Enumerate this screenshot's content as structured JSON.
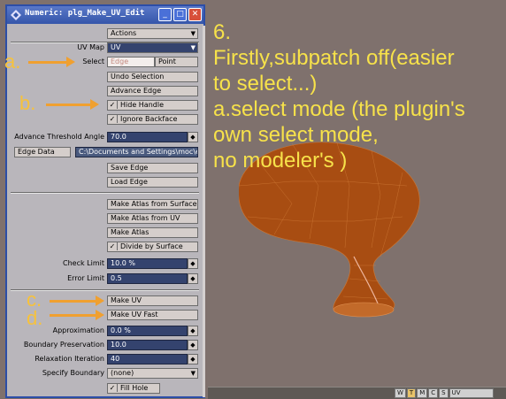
{
  "window": {
    "title": "Numeric: plg_Make_UV_Edit"
  },
  "controls": {
    "actions_label": "Actions",
    "uv_map_label": "UV Map",
    "uv_map_value": "UV",
    "select_label": "Select",
    "select_edge": "Edge",
    "select_point": "Point",
    "undo_selection": "Undo Selection",
    "advance_edge": "Advance Edge",
    "hide_handle": "Hide Handle",
    "ignore_backface": "Ignore Backface",
    "adv_threshold_label": "Advance Threshold Angle",
    "adv_threshold_value": "70.0",
    "edge_data_button": "Edge Data",
    "edge_data_path": "C:\\Documents and Settings\\moc\\ed",
    "save_edge": "Save Edge",
    "load_edge": "Load Edge",
    "make_atlas_surface": "Make Atlas from Surface",
    "make_atlas_uv": "Make Atlas from UV",
    "make_atlas": "Make Atlas",
    "divide_by_surface": "Divide by Surface",
    "check_limit_label": "Check Limit",
    "check_limit_value": "10.0 %",
    "error_limit_label": "Error Limit",
    "error_limit_value": "0.5",
    "make_uv": "Make UV",
    "make_uv_fast": "Make UV Fast",
    "approximation_label": "Approximation",
    "approximation_value": "0.0 %",
    "boundary_pres_label": "Boundary Preservation",
    "boundary_pres_value": "10.0",
    "relaxation_label": "Relaxation Iteration",
    "relaxation_value": "40",
    "specify_boundary_label": "Specify Boundary",
    "specify_boundary_value": "(none)",
    "fill_hole": "Fill Hole",
    "check_glyph": "✓",
    "stepper_glyph": "◆",
    "dropdown_glyph": "▼"
  },
  "annotations": {
    "a": "a.",
    "b": "b.",
    "c": "c.",
    "d": "d.",
    "line1": "6.",
    "line2": "Firstly,subpatch off(easier",
    "line3": "to select...)",
    "line4": "a.select mode (the plugin's",
    "line5": "own select mode,",
    "line6": "no modeler's )"
  },
  "statusbar": {
    "w": "W",
    "t": "T",
    "m": "M",
    "c": "C",
    "s": "S",
    "uv": "UV"
  },
  "colors": {
    "accent": "#f7c23b",
    "field": "#34436e",
    "panel": "#b9b6bb",
    "mesh": "#b25413"
  }
}
